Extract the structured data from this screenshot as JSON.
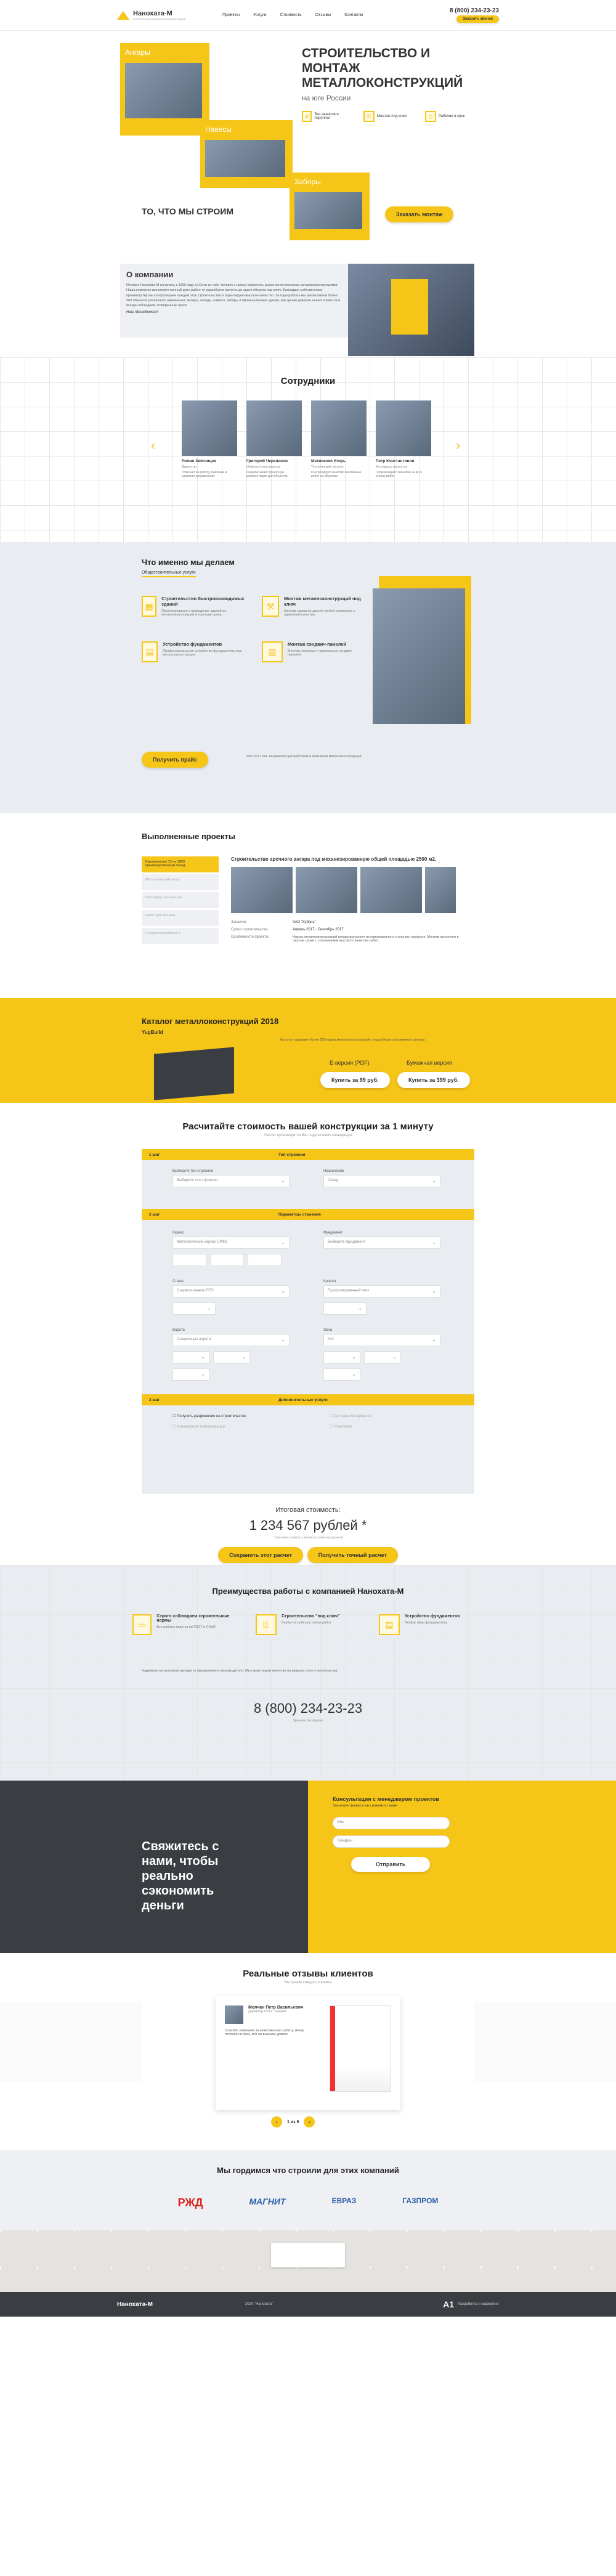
{
  "header": {
    "logo": "Нанохата-М",
    "logo_sub": "строительство и монтаж металлоконструкций",
    "nav": [
      "Проекты",
      "Услуги",
      "Стоимость",
      "Отзывы",
      "Контакты"
    ],
    "phone": "8 (800) 234-23-23",
    "callback": "Заказать звонок"
  },
  "hero": {
    "cards": [
      "Ангары",
      "Навесы",
      "Заборы"
    ],
    "title": "СТРОИТЕЛЬСТВО И МОНТАЖ МЕТАЛЛОКОНСТРУКЦИЙ",
    "subtitle": "на юге России",
    "features": [
      "Без авансов и переплат",
      "Монтаж под ключ",
      "Рабочие в срок"
    ],
    "cta": "Заказать монтаж",
    "tagline": "ТО, ЧТО МЫ СТРОИМ"
  },
  "about": {
    "title": "О компании",
    "text": "История Нанохата-М началась в 1996 году в г.Сочи из трёх человек с целью наполнить рынок качественными металлоконструкциями. Наша компания выполняет полный цикл работ: от разработки проекта до сдачи объекта под ключ. Благодаря собственному производству мы контролируем каждый этап строительства и гарантируем высокое качество. За годы работы мы реализовали более 500 объектов различного назначения: ангары, склады, навесы, заборы и промышленные здания. Мы ценим доверие наших клиентов и всегда соблюдаем оговорённые сроки.",
    "sign": "Наш Менеджмент"
  },
  "staff": {
    "title": "Сотрудники",
    "people": [
      {
        "name": "Роман Звягинцев",
        "role": "Директор",
        "text": "Отвечает за работу компании и развитие направлений."
      },
      {
        "name": "Григорий Черепанов",
        "role": "Инженер-конструктор",
        "text": "Разрабатывает проектную документацию для объектов."
      },
      {
        "name": "Матвиенко Игорь",
        "role": "Технический эксперт",
        "text": "Контролирует качество монтажных работ на объектах."
      },
      {
        "name": "Петр Константинов",
        "role": "Менеджер проектов",
        "text": "Сопровождает клиентов на всех этапах работ."
      }
    ]
  },
  "services": {
    "title": "Что именно мы делаем",
    "tab": "Общестроительные услуги",
    "items": [
      {
        "t": "Строительство быстровозводимых зданий",
        "d": "Проектирование и возведение зданий из металлоконструкций в короткие сроки."
      },
      {
        "t": "Монтаж металлоконструкций под ключ",
        "d": "Монтаж каркасов зданий любой сложности с гарантией качества."
      },
      {
        "t": "Устройство фундаментов",
        "d": "Профессиональное устройство фундаментов под металлоконструкции."
      },
      {
        "t": "Монтаж сэндвич-панелей",
        "d": "Монтаж стеновых и кровельных сэндвич-панелей."
      }
    ],
    "cta": "Получить прайс",
    "note": "Уже 2017 лет занимаемся разработкой и монтажом металлоконструкций"
  },
  "projects": {
    "title": "Выполненные проекты",
    "tabs": [
      "Бурлаковская 13 на 3800 производственный склад",
      "Металлический ангар",
      "Производственный цех",
      "Навес для техники",
      "Складской комплекс 3"
    ],
    "heading": "Строительство арочного ангара под механизированную общей площадью 2500 м2.",
    "rows": [
      {
        "k": "Заказчик:",
        "v": "ЗАО \"Кубань\""
      },
      {
        "k": "Сроки строительства:",
        "v": "Апрель 2017 - Сентябрь 2017"
      },
      {
        "k": "Особенности проекта:",
        "v": "Каркас металлоконструкций ангара выполнен из оцинкованного стального профиля. Монтаж выполнен в сжатые сроки с сохранением высокого качества работ."
      }
    ]
  },
  "catalog": {
    "title": "Каталог металлоконструкций 2018",
    "brand": "YugBuild",
    "desc": "Каталог содержит более 250 видов металлоконструкций с подробным описанием и ценами.",
    "pdf": "Е-версия (PDF)",
    "paper": "Бумажная версия",
    "buy_pdf": "Купить за 99 руб.",
    "buy_paper": "Купить за 399 руб."
  },
  "calc": {
    "title": "Расчитайте стоимость вашей конструкции за 1 минуту",
    "sub": "Расчёт производится без подключения менеджера",
    "step1": "1 шаг",
    "step1t": "Тип строения",
    "l_type": "Выберите тип строения",
    "v_type": "Выберите тип строения",
    "l_purpose": "Назначение",
    "v_purpose": "Склад",
    "step2": "2 шаг",
    "step2t": "Параметры строения",
    "l_frame": "Каркас",
    "v_frame": "Металлический каркас (ЛМК)",
    "l_found": "Фундамент",
    "v_found": "Выберите фундамент",
    "l_walls": "Стены",
    "v_walls": "Сэндвич-панели ППУ",
    "l_roof": "Кровля",
    "v_roof": "Профилированный лист",
    "l_gates": "Ворота",
    "v_gates": "Секционные ворота",
    "l_windows": "Окна",
    "v_windows": "Нет",
    "step3": "3 шаг",
    "step3t": "Дополнительные услуги",
    "opts": [
      "Получить разрешение на строительство",
      "Доставка материалов",
      "Инженерные коммуникации",
      "Утепление"
    ],
    "total_l": "Итоговая стоимость:",
    "total": "1 234 567 рублей *",
    "note": "* итоговая стоимость является ориентировочной",
    "save": "Сохранить этот расчет",
    "send": "Получить точный расчет"
  },
  "adv": {
    "title": "Преимущества работы с компанией Нанохата-М",
    "items": [
      {
        "t": "Строго соблюдаем строительные нормы",
        "d": "Все работы ведутся по ГОСТ и СНиП."
      },
      {
        "t": "Строительство \"под ключ\"",
        "d": "Берём на себя все этапы работ."
      },
      {
        "t": "Устройство фундаментов",
        "d": "Любые типы фундаментов."
      }
    ],
    "text": "Надежные металлоконструкции от проверенного производителя. Мы гарантируем качество на каждом этапе строительства.",
    "phone": "8 (800) 234-23-23",
    "phone_sub": "Звоните бесплатно"
  },
  "contact": {
    "big": "Свяжитесь с нами, чтобы реально сэкономить деньги",
    "title": "Консультация с менеджером проектов",
    "sub": "Заполните форму и мы свяжемся с вами",
    "name": "Имя",
    "phone": "Телефон",
    "send": "Отправить"
  },
  "reviews": {
    "title": "Реальные отзывы клиентов",
    "sub": "Мы ценим каждого клиента",
    "name": "Молчан Петр Васильевич",
    "pos": "Директор ООО \"Тандем\"",
    "text": "Спасибо компании за качественную работу. Ангар построен в срок, всё на высшем уровне.",
    "pager": "1 из 6"
  },
  "partners": {
    "title": "Мы гордимся что строили для этих компаний",
    "logos": [
      "РЖД",
      "МАГНИТ",
      "ЕВРАЗ",
      "ГАЗПРОМ"
    ]
  },
  "footer": {
    "logo": "Нанохата-М",
    "mid": "2020 \"Нанохата\"",
    "dev": "Разработка и маркетинг"
  },
  "colors": {
    "accent": "#f5c518",
    "dark": "#3a3d42"
  }
}
